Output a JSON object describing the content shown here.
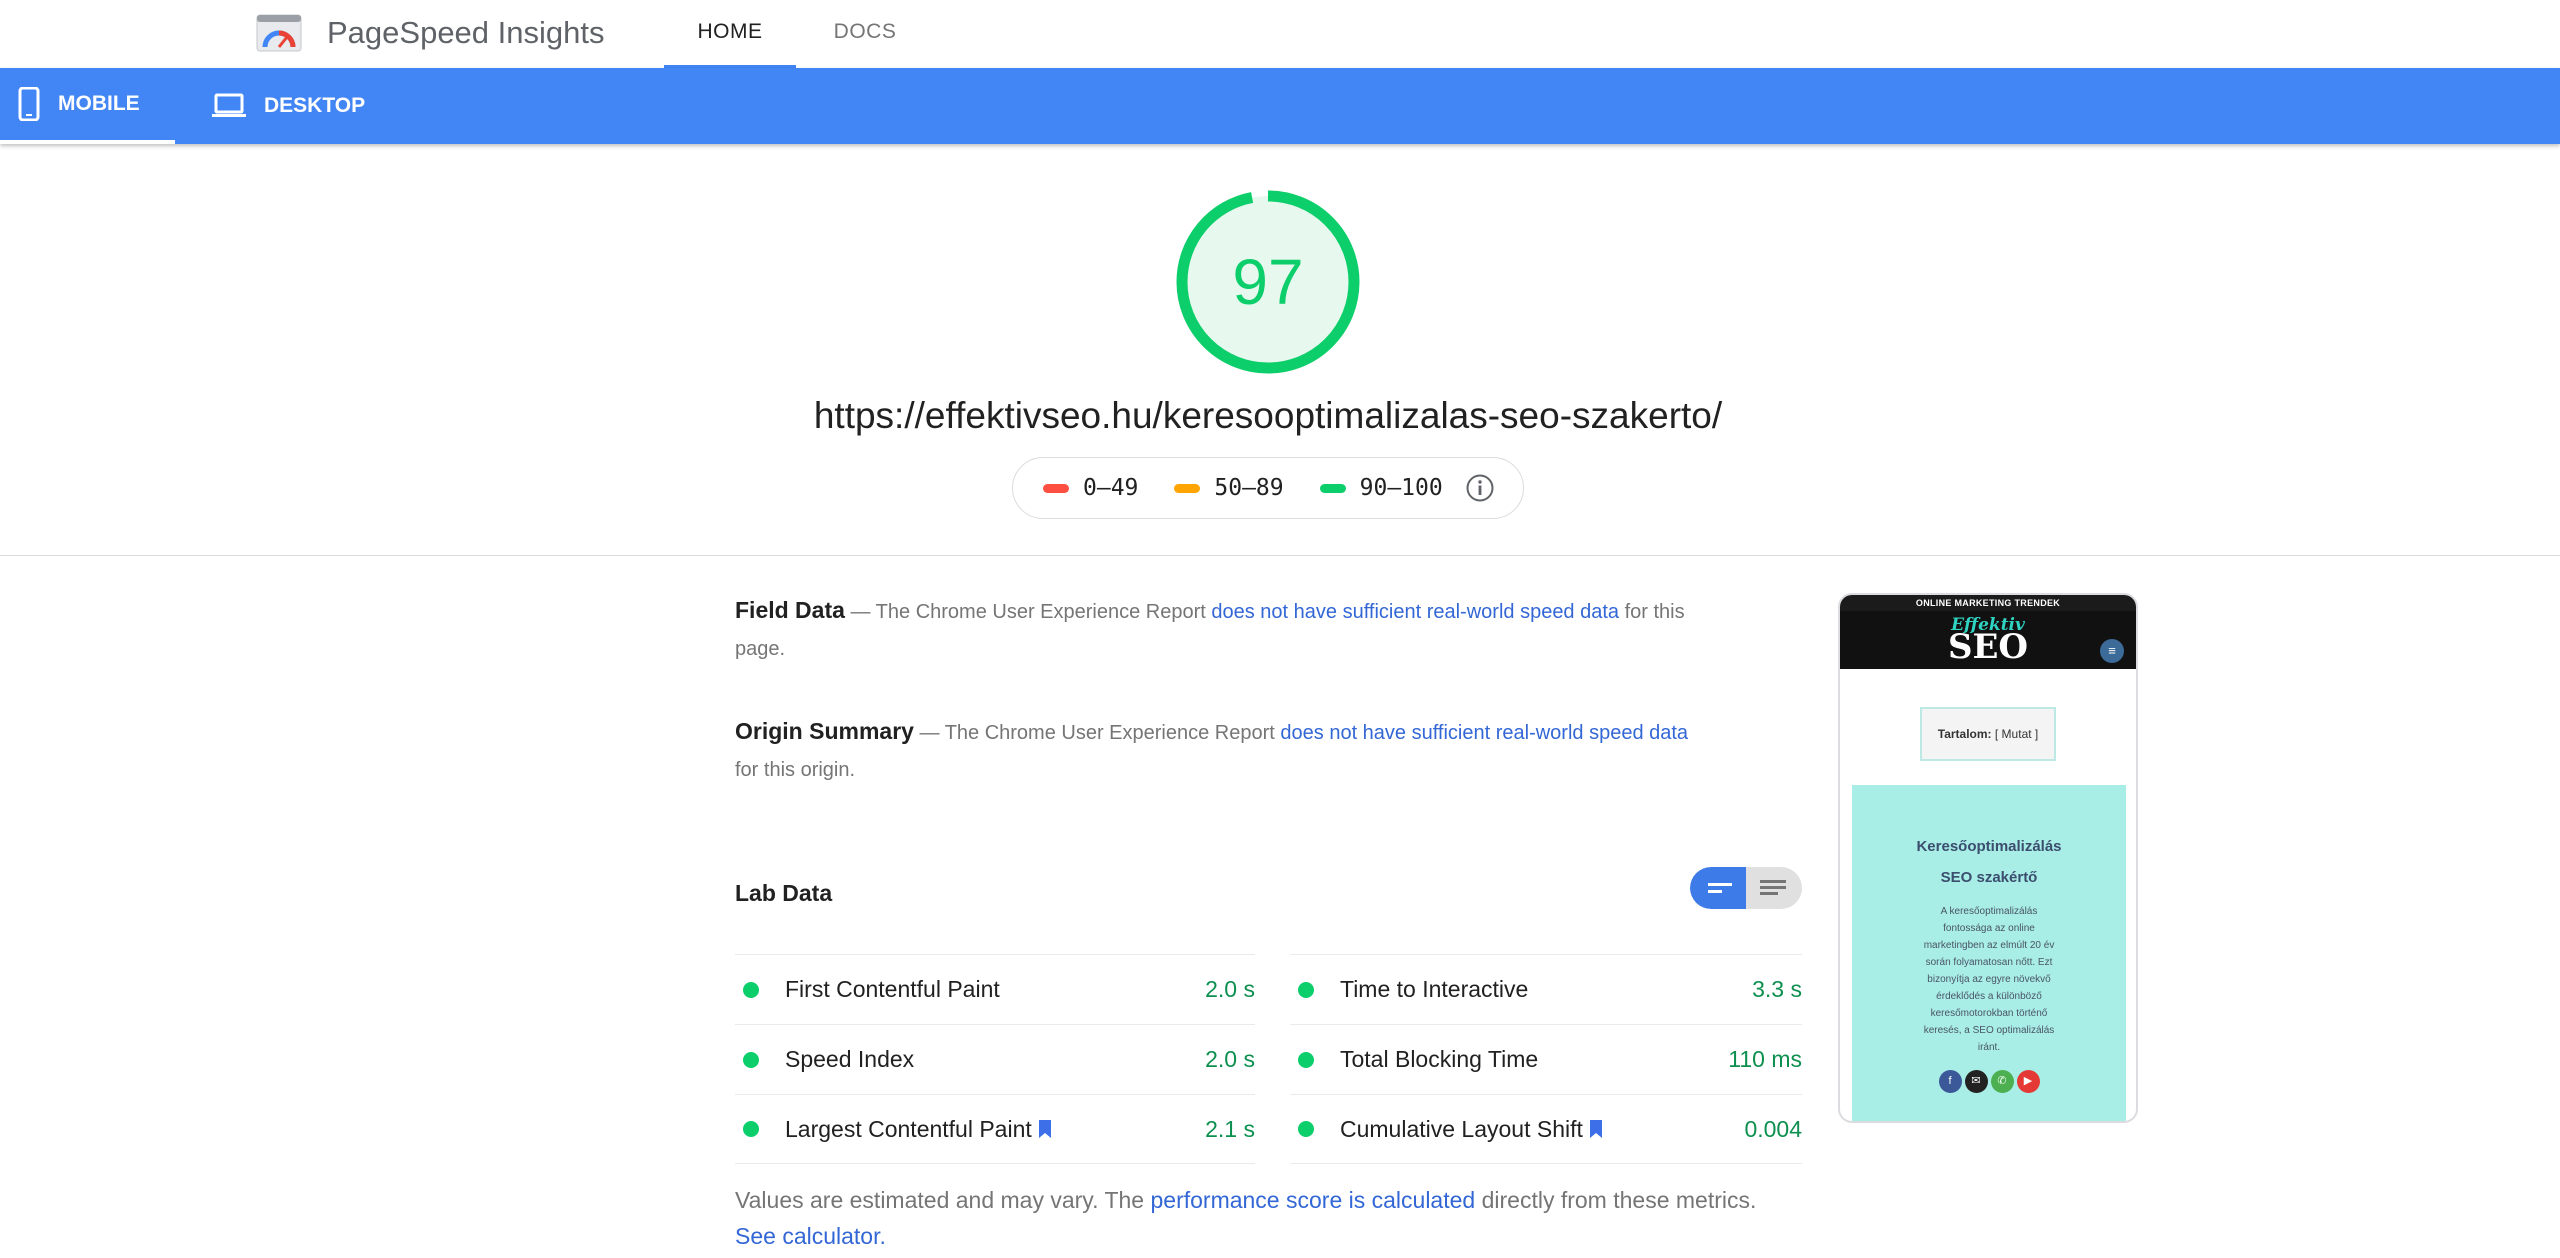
{
  "header": {
    "brand": "PageSpeed Insights",
    "nav": [
      {
        "label": "HOME",
        "active": true
      },
      {
        "label": "DOCS",
        "active": false
      }
    ]
  },
  "device_tabs": [
    {
      "label": "MOBILE",
      "icon": "phone-icon",
      "active": true
    },
    {
      "label": "DESKTOP",
      "icon": "laptop-icon",
      "active": false
    }
  ],
  "score": {
    "value": "97",
    "fraction": 0.97,
    "color": "#0cce6b"
  },
  "url": "https://effektivseo.hu/keresooptimalizalas-seo-szakerto/",
  "legend": [
    {
      "range": "0–49",
      "color": "#ff4e42"
    },
    {
      "range": "50–89",
      "color": "#ffa400"
    },
    {
      "range": "90–100",
      "color": "#0cce6b"
    }
  ],
  "field_data": {
    "title": "Field Data",
    "text_before": " — The Chrome User Experience Report ",
    "link": "does not have sufficient real-world speed data",
    "text_after": " for this page."
  },
  "origin_summary": {
    "title": "Origin Summary",
    "text_before": " — The Chrome User Experience Report ",
    "link": "does not have sufficient real-world speed data",
    "text_after": " for this origin."
  },
  "lab_data": {
    "title": "Lab Data",
    "metrics_left": [
      {
        "label": "First Contentful Paint",
        "value": "2.0 s",
        "bookmark": false
      },
      {
        "label": "Speed Index",
        "value": "2.0 s",
        "bookmark": false
      },
      {
        "label": "Largest Contentful Paint",
        "value": "2.1 s",
        "bookmark": true
      }
    ],
    "metrics_right": [
      {
        "label": "Time to Interactive",
        "value": "3.3 s",
        "bookmark": false
      },
      {
        "label": "Total Blocking Time",
        "value": "110 ms",
        "bookmark": false
      },
      {
        "label": "Cumulative Layout Shift",
        "value": "0.004",
        "bookmark": true
      }
    ]
  },
  "footnote": {
    "text1": "Values are estimated and may vary. The ",
    "link1": "performance score is calculated",
    "text2": " directly from these metrics. ",
    "link2": "See calculator."
  },
  "thumbnail": {
    "top_banner": "ONLINE MARKETING TRENDEK",
    "logo_line1": "Effektiv",
    "logo_line2": "SEO",
    "toc_label": "Tartalom:",
    "toc_toggle": "[ Mutat ]",
    "hero_title_1": "Keresőoptimalizálás",
    "hero_title_2": "SEO szakértő",
    "hero_text": "A keresőoptimalizálás fontossága az online marketingben az elmúlt 20 év során folyamatosan nőtt. Ezt bizonyítja az egyre növekvő érdeklődés a különböző keresőmotorokban történő keresés, a SEO optimalizálás iránt.",
    "social": [
      {
        "icon": "facebook-icon",
        "glyph": "f",
        "color": "#3b5998"
      },
      {
        "icon": "email-icon",
        "glyph": "✉",
        "color": "#222222"
      },
      {
        "icon": "phone-call-icon",
        "glyph": "✆",
        "color": "#4caf50"
      },
      {
        "icon": "youtube-icon",
        "glyph": "▶",
        "color": "#e53935"
      }
    ]
  }
}
